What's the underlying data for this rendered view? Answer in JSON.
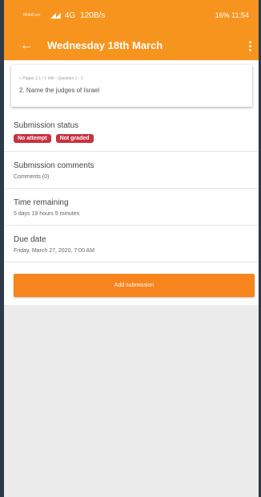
{
  "status_bar": {
    "carrier": "MobiCom",
    "network": "4G",
    "speed": "120B/s",
    "right": "16% 11:54"
  },
  "app_bar": {
    "back_icon": "arrow-left-icon",
    "title": "Wednesday 18th March",
    "menu_icon": "more-vert-icon"
  },
  "question_card": {
    "breadcrumb": "< Pages 1-1 / 1 Info - Question 1 - 1",
    "question": "2. Name the judges of Israel"
  },
  "submission_status": {
    "label": "Submission status",
    "badges": [
      "No attempt",
      "Not graded"
    ]
  },
  "submission_comments": {
    "label": "Submission comments",
    "value": "Comments (0)"
  },
  "time_remaining": {
    "label": "Time remaining",
    "value": "5 days 19 hours 5 minutes"
  },
  "due_date": {
    "label": "Due date",
    "value": "Friday, March 27, 2020, 7:00 AM"
  },
  "actions": {
    "add_submission": "Add submission"
  },
  "colors": {
    "accent": "#f7941d",
    "badge": "#c8323f",
    "frame_bg": "#2c3a4a"
  }
}
